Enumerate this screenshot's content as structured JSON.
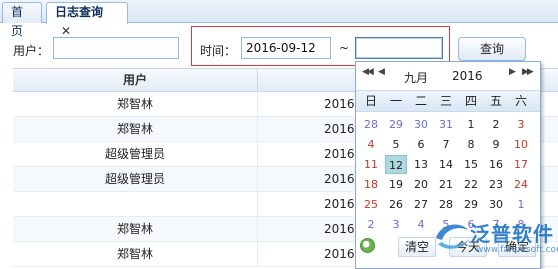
{
  "tabs": [
    {
      "label": "首页"
    },
    {
      "label": "日志查询",
      "close": "✕"
    }
  ],
  "filters": {
    "user_label": "用户：",
    "user_value": "",
    "time_label": "时间：",
    "start_value": "2016-09-12",
    "range_sep": "~",
    "end_value": "",
    "query_button": "查询"
  },
  "grid": {
    "columns": [
      "用户",
      ""
    ],
    "rows": [
      {
        "user": "郑智林",
        "time": "2016"
      },
      {
        "user": "郑智林",
        "time": "2016"
      },
      {
        "user": "超级管理员",
        "time": "2016"
      },
      {
        "user": "超级管理员",
        "time": "2016"
      },
      {
        "user": "",
        "time": "2016"
      },
      {
        "user": "郑智林",
        "time": "2016"
      },
      {
        "user": "郑智林",
        "time": "2016-09-12 15:53"
      }
    ]
  },
  "calendar": {
    "prev_year": "◀◀",
    "prev_month": "◀",
    "next_month": "▶",
    "next_year": "▶▶",
    "month": "九月",
    "year": "2016",
    "weekdays": [
      "日",
      "一",
      "二",
      "三",
      "四",
      "五",
      "六"
    ],
    "weeks": [
      [
        "28",
        "29",
        "30",
        "31",
        "1",
        "2",
        "3"
      ],
      [
        "4",
        "5",
        "6",
        "7",
        "8",
        "9",
        "10"
      ],
      [
        "11",
        "12",
        "13",
        "14",
        "15",
        "16",
        "17"
      ],
      [
        "18",
        "19",
        "20",
        "21",
        "22",
        "23",
        "24"
      ],
      [
        "25",
        "26",
        "27",
        "28",
        "29",
        "30",
        "1"
      ],
      [
        "2",
        "3",
        "4",
        "5",
        "6",
        "7",
        "8"
      ]
    ],
    "selected_day": "12",
    "clear_button": "清空",
    "today_button": "今天",
    "ok_button": "确定"
  },
  "watermark": {
    "brand": "泛普软件",
    "url": "www.fanpusoft.com"
  },
  "colors": {
    "highlight_border": "#d83b3b",
    "header_blue": "#0e2d5f",
    "border_blue": "#95b8e7",
    "selected_day": "#aed8e0"
  }
}
